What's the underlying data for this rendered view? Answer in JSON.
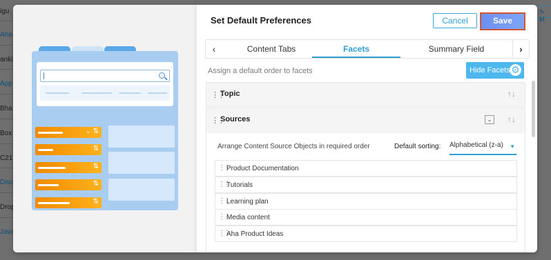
{
  "background": {
    "items": [
      {
        "text": "igu",
        "link": false
      },
      {
        "text": "Aha",
        "link": true
      },
      {
        "text": "anki",
        "link": false
      },
      {
        "text": "App",
        "link": true
      },
      {
        "text": "Bha",
        "link": false
      },
      {
        "text": "Box",
        "link": false
      },
      {
        "text": "C21",
        "link": false
      },
      {
        "text": "Disc",
        "link": true
      },
      {
        "text": "Drop",
        "link": false
      },
      {
        "text": "Java",
        "link": true
      }
    ],
    "right_button_label": "M"
  },
  "modal": {
    "title": "Set Default Preferences",
    "cancel_label": "Cancel",
    "save_label": "Save",
    "tabs": {
      "prev_icon": "‹",
      "next_icon": "›",
      "items": [
        {
          "label": "Content Tabs",
          "active": false
        },
        {
          "label": "Facets",
          "active": true
        },
        {
          "label": "Summary Field",
          "active": false
        }
      ]
    },
    "hint": "Assign a default order to facets",
    "hide_facets_label": "Hide Facets",
    "facets": [
      {
        "name": "Topic"
      },
      {
        "name": "Sources"
      }
    ],
    "sources": {
      "arrange_label": "Arrange Content Source Objects in required order",
      "default_sorting_label": "Default sorting:",
      "default_sorting_value": "Alphabetical (z-a)",
      "objects": [
        "Product Documentation",
        "Tutorials",
        "Learning plan",
        "Media content",
        "Aha Product Ideas"
      ]
    }
  },
  "colors": {
    "accent": "#2f9fd3",
    "save_border": "#d2562f",
    "orange": "#f18a00",
    "illustration_blue": "#a9cdf1"
  },
  "icons": {
    "grip": "drag-handle-icon",
    "sort": "sort-arrows-icon",
    "gear": "gear-icon",
    "chevron": "chevron-down-icon",
    "search": "search-icon"
  }
}
